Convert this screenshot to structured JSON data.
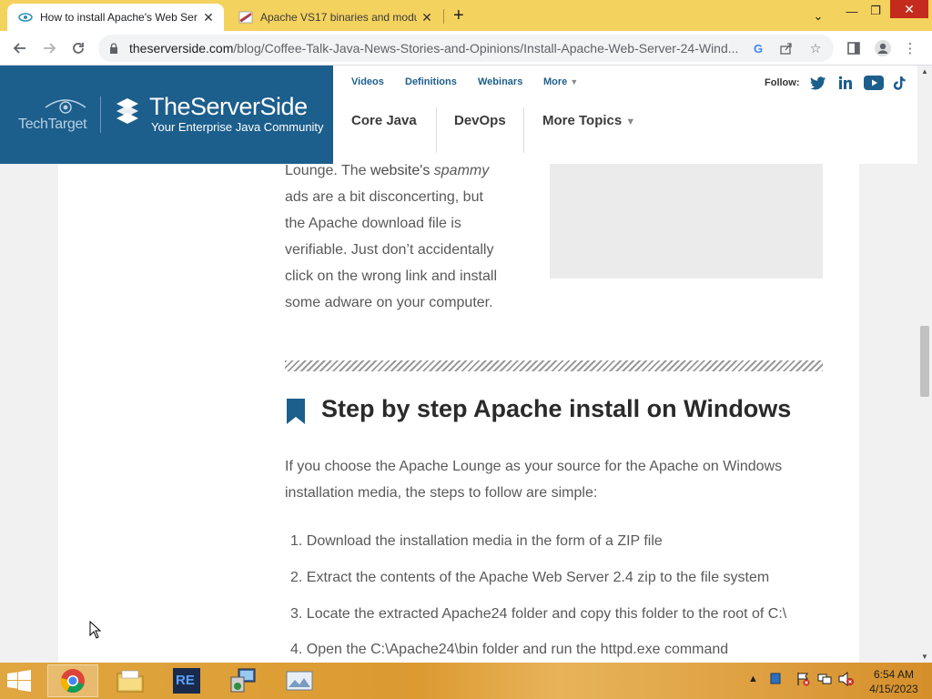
{
  "browser": {
    "tabs": [
      {
        "title": "How to install Apache's Web Ser",
        "favicon": "tss-eye-icon",
        "active": true
      },
      {
        "title": "Apache VS17 binaries and modul",
        "favicon": "apache-feather-icon",
        "active": false
      }
    ],
    "new_tab_symbol": "+",
    "url_host": "theserverside.com",
    "url_path": "/blog/Coffee-Talk-Java-News-Stories-and-Opinions/Install-Apache-Web-Server-24-Wind..."
  },
  "site": {
    "brand_techtarget": "TechTarget",
    "brand_name": "TheServerSide",
    "brand_tagline": "Your Enterprise Java Community",
    "topnav": {
      "videos": "Videos",
      "definitions": "Definitions",
      "webinars": "Webinars",
      "more": "More"
    },
    "follow_label": "Follow:",
    "mainnav": {
      "core_java": "Core Java",
      "devops": "DevOps",
      "more_topics": "More Topics"
    }
  },
  "article": {
    "para_lines": {
      "l1a": "Lounge. The ",
      "l1link": "website's",
      "l1em": "spammy",
      "l2": "ads are a bit disconcerting, but",
      "l3": "the Apache download file is",
      "l4": "verifiable. Just don’t accidentally",
      "l5": "click on the wrong link and install",
      "l6": "some adware on your computer."
    },
    "heading": "Step by step Apache install on Windows",
    "intro": "If you choose the Apache Lounge as your source for the Apache on Windows installation media, the steps to follow are simple:",
    "steps": [
      "1. Download the installation media in the form of a ZIP file",
      "2. Extract the contents of the Apache Web Server 2.4 zip to the file system",
      "3. Locate the extracted Apache24 folder and copy this folder to the root of C:\\",
      "4. Open the C:\\Apache24\\bin folder and run the httpd.exe command"
    ]
  },
  "taskbar": {
    "apps": [
      "chrome-icon",
      "file-explorer-icon",
      "re-app-icon",
      "network-tool-icon",
      "image-viewer-icon"
    ],
    "time": "6:54 AM",
    "date": "4/15/2023"
  },
  "colors": {
    "brand_blue": "#1c5e8c",
    "tab_strip": "#f4d25e",
    "taskbar": "#dc9a31"
  }
}
